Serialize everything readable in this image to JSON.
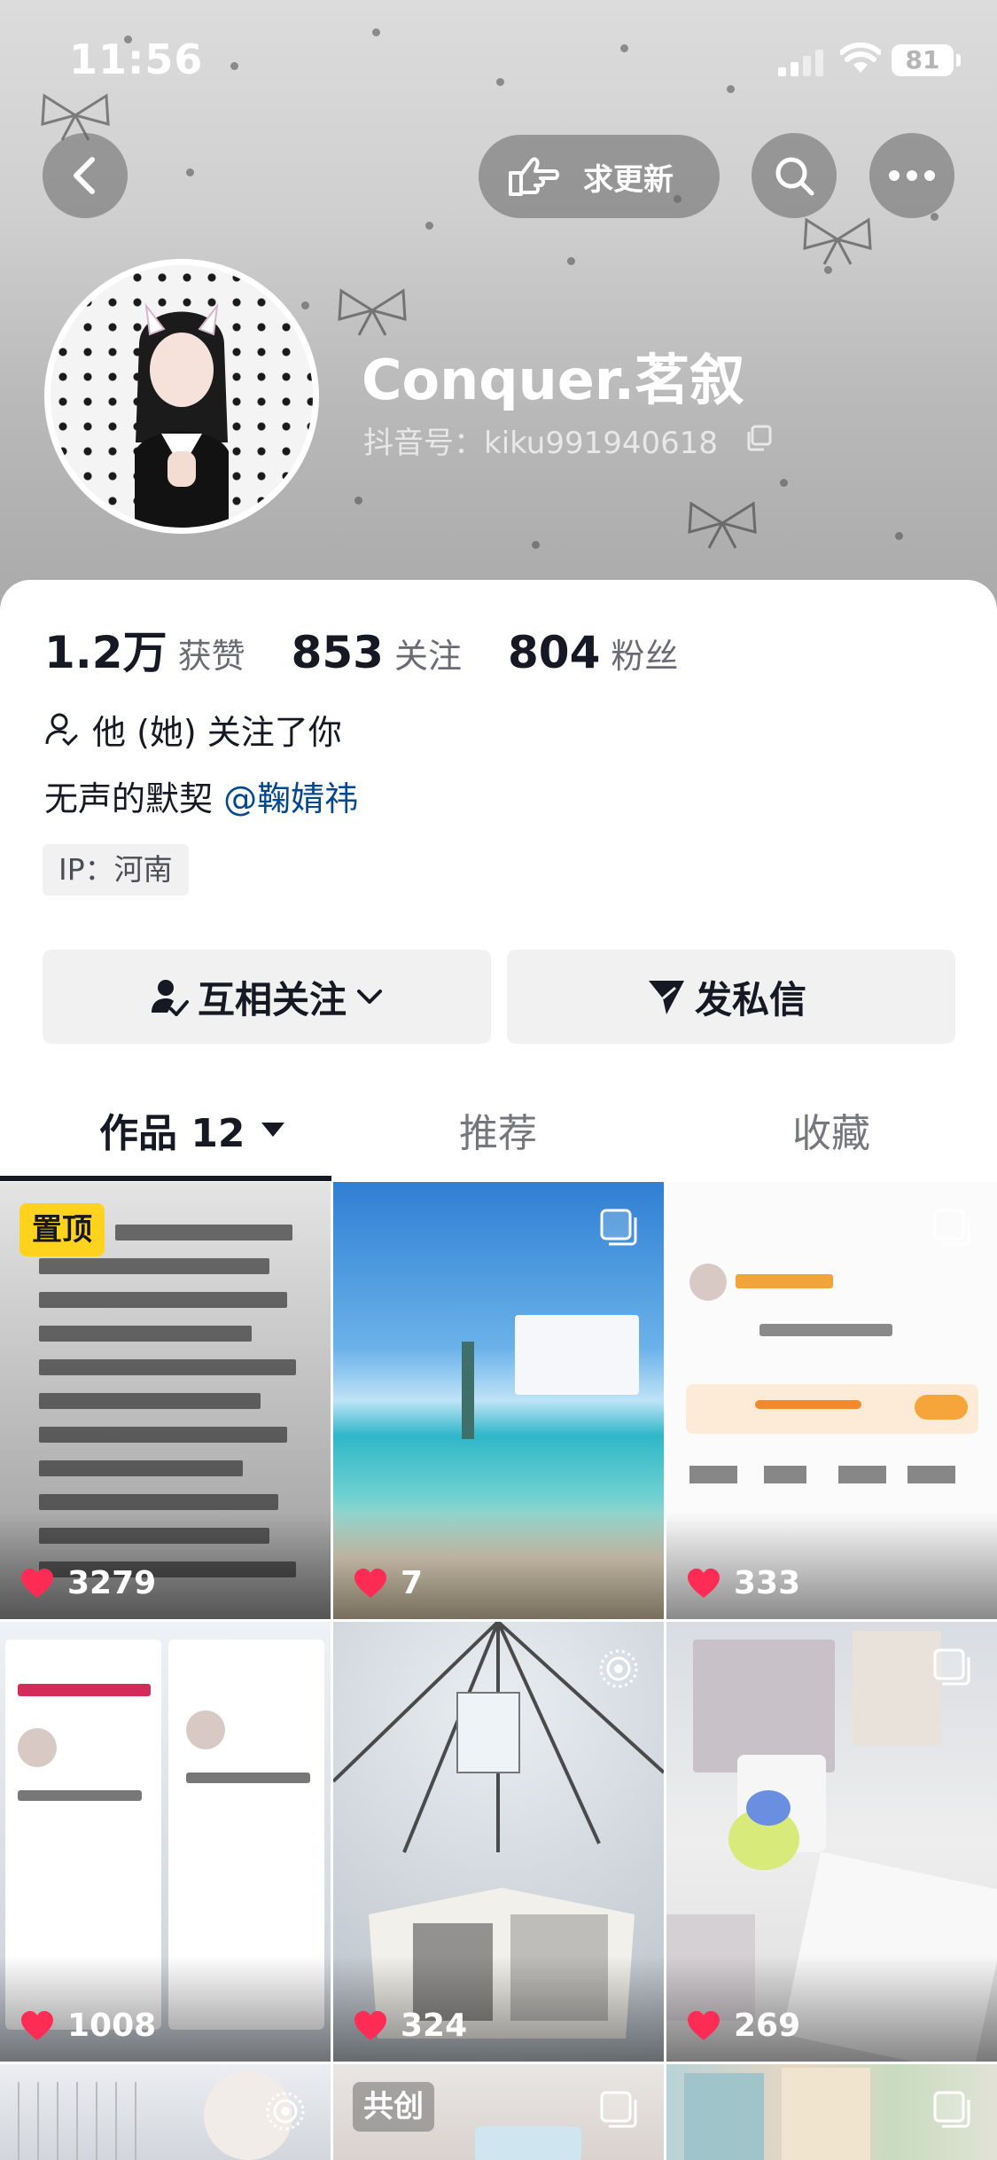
{
  "status_bar": {
    "time": "11:56",
    "battery": "81"
  },
  "header": {
    "update_label": "求更新"
  },
  "profile": {
    "nickname": "Conquer.茗叙",
    "douyin_id": "抖音号：kiku991940618",
    "stats": [
      {
        "value": "1.2万",
        "label": "获赞"
      },
      {
        "value": "853",
        "label": "关注"
      },
      {
        "value": "804",
        "label": "粉丝"
      }
    ],
    "follow_you_text": "他 (她) 关注了你",
    "bio_text": "无声的默契 ",
    "bio_mention": "@鞠婧祎",
    "ip_text": "IP：河南"
  },
  "actions": {
    "mutual_follow": "互相关注",
    "message": "发私信"
  },
  "tabs": [
    {
      "label": "作品 12",
      "active": true
    },
    {
      "label": "推荐",
      "active": false
    },
    {
      "label": "收藏",
      "active": false
    }
  ],
  "videos": [
    {
      "likes": "3279",
      "badge": "置顶"
    },
    {
      "likes": "7"
    },
    {
      "likes": "333"
    },
    {
      "likes": "1008"
    },
    {
      "likes": "324"
    },
    {
      "likes": "269"
    },
    {
      "likes": ""
    },
    {
      "likes": "",
      "badge": "共创"
    },
    {
      "likes": ""
    }
  ],
  "colors": {
    "like_heart": "#fe2c55",
    "pin_badge": "#ffd21e",
    "mention": "#04498d"
  }
}
